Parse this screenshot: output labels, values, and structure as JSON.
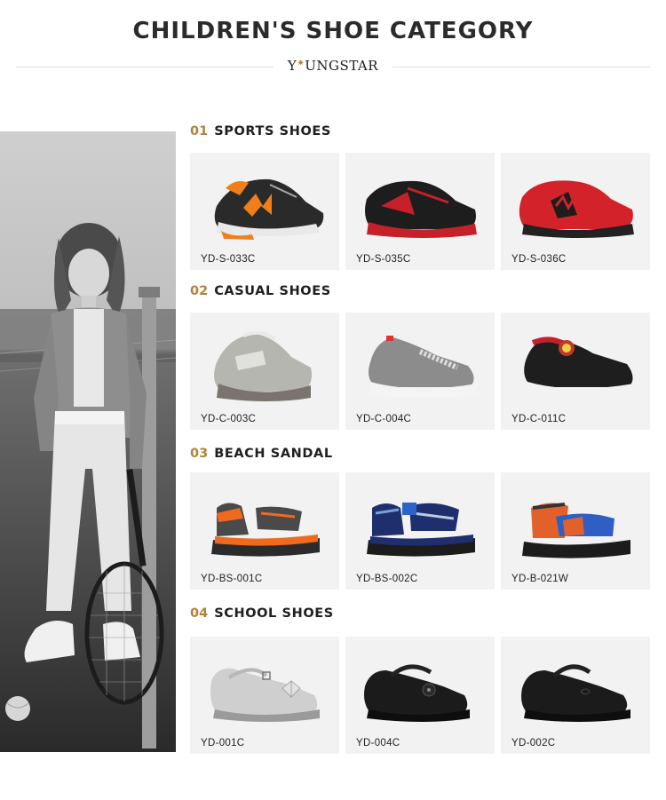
{
  "header": {
    "title": "CHILDREN'S SHOE CATEGORY",
    "brand_prefix": "Y",
    "brand_suffix": "UNGSTAR"
  },
  "sections": [
    {
      "num": "01",
      "name": "SPORTS SHOES",
      "items": [
        {
          "code": "YD-S-033C",
          "icon": "sneaker-black-orange"
        },
        {
          "code": "YD-S-035C",
          "icon": "sneaker-black-red"
        },
        {
          "code": "YD-S-036C",
          "icon": "sneaker-red"
        }
      ]
    },
    {
      "num": "02",
      "name": "CASUAL SHOES",
      "items": [
        {
          "code": "YD-C-003C",
          "icon": "sneaker-grey-light"
        },
        {
          "code": "YD-C-004C",
          "icon": "slip-on-grey"
        },
        {
          "code": "YD-C-011C",
          "icon": "slip-on-black"
        }
      ]
    },
    {
      "num": "03",
      "name": "BEACH SANDAL",
      "items": [
        {
          "code": "YD-BS-001C",
          "icon": "sandal-grey-orange"
        },
        {
          "code": "YD-BS-002C",
          "icon": "sandal-navy"
        },
        {
          "code": "YD-B-021W",
          "icon": "sandal-orange-blue"
        }
      ]
    },
    {
      "num": "04",
      "name": "SCHOOL SHOES",
      "items": [
        {
          "code": "YD-001C",
          "icon": "mary-jane-silver"
        },
        {
          "code": "YD-004C",
          "icon": "mary-jane-black-flower"
        },
        {
          "code": "YD-002C",
          "icon": "mary-jane-black"
        }
      ]
    }
  ],
  "colors": {
    "accent": "#b5803a",
    "card_bg": "#f2f2f2",
    "title": "#2b2b2b"
  }
}
